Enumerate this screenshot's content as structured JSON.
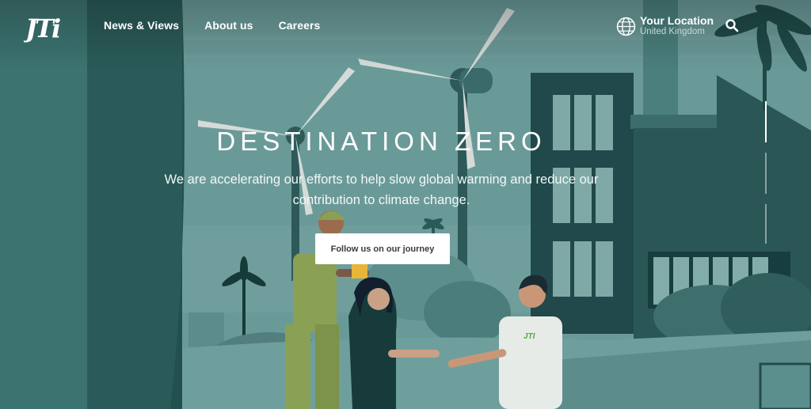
{
  "nav": {
    "logo_text": "JTI",
    "links": [
      "News & Views",
      "About us",
      "Careers"
    ]
  },
  "location": {
    "title": "Your Location",
    "country": "United Kingdom"
  },
  "hero": {
    "title": "DESTINATION ZERO",
    "subtitle": "We are accelerating our efforts to help slow global warming and reduce our contribution to climate change.",
    "cta_label": "Follow us on our journey",
    "shirt_logo": "JTI"
  },
  "slider": {
    "slides": 3,
    "active_index": 0
  },
  "colors": {
    "sky": "#6e9f9d",
    "dark_teal": "#1f4848",
    "mid_teal": "#4f807e",
    "button_bg": "#ffffff",
    "button_text": "#3b3b3b",
    "brand_green": "#4caa3c"
  }
}
